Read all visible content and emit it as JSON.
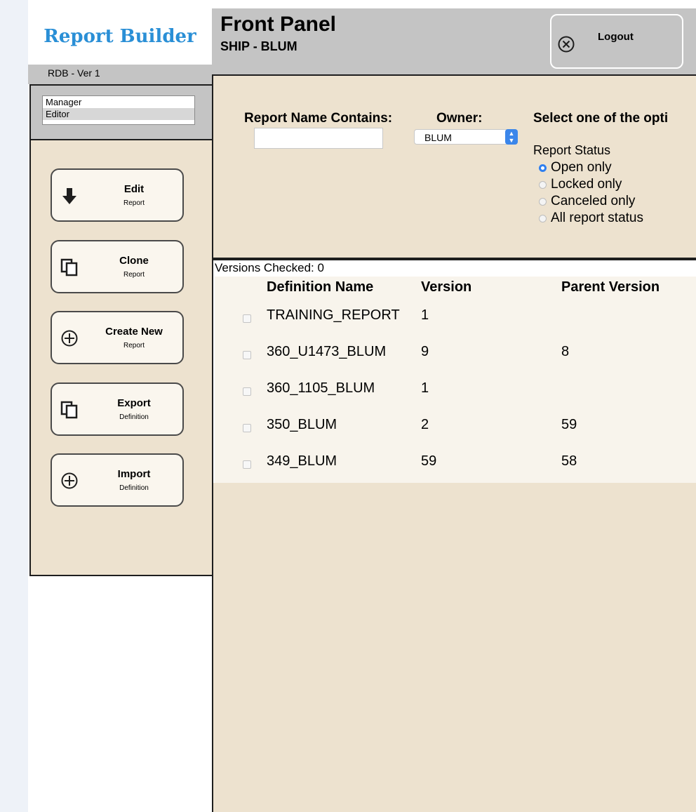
{
  "app": {
    "brand": "Report Builder",
    "version_text": "RDB -  Ver 1"
  },
  "roles": [
    "Manager",
    "Editor"
  ],
  "actions": [
    {
      "title": "Edit",
      "sub": "Report",
      "icon": "arrow-down-icon"
    },
    {
      "title": "Clone",
      "sub": "Report",
      "icon": "copy-icon"
    },
    {
      "title": "Create New",
      "sub": "Report",
      "icon": "plus-circle-icon"
    },
    {
      "title": "Export",
      "sub": "Definition",
      "icon": "copy-icon"
    },
    {
      "title": "Import",
      "sub": "Definition",
      "icon": "plus-circle-icon"
    }
  ],
  "header": {
    "title": "Front Panel",
    "subtitle": "SHIP - BLUM",
    "logout_label": "Logout"
  },
  "filters": {
    "report_name_label": "Report Name Contains:",
    "report_name_value": "",
    "owner_label": "Owner:",
    "owner_value": "BLUM",
    "select_one_label": "Select one of the opti",
    "status_label": "Report Status",
    "status_options": [
      {
        "label": "Open only",
        "selected": true
      },
      {
        "label": "Locked only",
        "selected": false
      },
      {
        "label": "Canceled only",
        "selected": false
      },
      {
        "label": "All report status",
        "selected": false
      }
    ]
  },
  "table": {
    "versions_checked": "Versions Checked: 0",
    "columns": [
      "Definition Name",
      "Version",
      "Parent Version"
    ],
    "rows": [
      {
        "name": "TRAINING_REPORT",
        "version": "1",
        "parent": ""
      },
      {
        "name": "360_U1473_BLUM",
        "version": "9",
        "parent": "8"
      },
      {
        "name": "360_1105_BLUM",
        "version": "1",
        "parent": ""
      },
      {
        "name": "350_BLUM",
        "version": "2",
        "parent": "59"
      },
      {
        "name": "349_BLUM",
        "version": "59",
        "parent": "58"
      }
    ]
  },
  "colors": {
    "brand": "#2a8fd6",
    "panel_tan": "#ede2cf",
    "header_gray": "#c4c4c4",
    "radio_accent": "#2f7ff0"
  }
}
